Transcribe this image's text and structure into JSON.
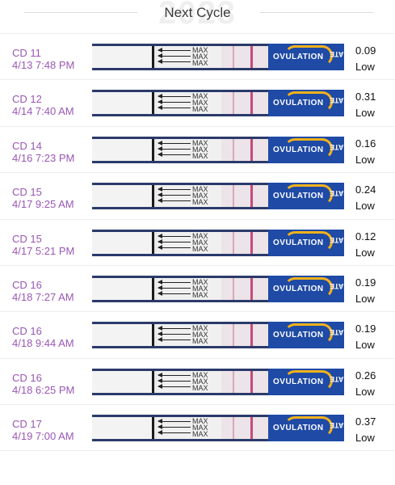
{
  "header": {
    "title": "Next Cycle",
    "watermark": "2023"
  },
  "strip_text": {
    "max_label": "MAX",
    "brand_word": "OVULATION",
    "brand_word_reversed": "MATE"
  },
  "colors": {
    "date_purple": "#9a57b5",
    "brand_blue": "#1f4aa5",
    "brand_yellow": "#f4b21b",
    "control_line": "#c84a7a"
  },
  "tests": [
    {
      "cycle_day": "CD 11",
      "timestamp": "4/13 7:48 PM",
      "value": "0.09",
      "level": "Low"
    },
    {
      "cycle_day": "CD 12",
      "timestamp": "4/14 7:40 AM",
      "value": "0.31",
      "level": "Low"
    },
    {
      "cycle_day": "CD 14",
      "timestamp": "4/16 7:23 PM",
      "value": "0.16",
      "level": "Low"
    },
    {
      "cycle_day": "CD 15",
      "timestamp": "4/17 9:25 AM",
      "value": "0.24",
      "level": "Low"
    },
    {
      "cycle_day": "CD 15",
      "timestamp": "4/17 5:21 PM",
      "value": "0.12",
      "level": "Low"
    },
    {
      "cycle_day": "CD 16",
      "timestamp": "4/18 7:27 AM",
      "value": "0.19",
      "level": "Low"
    },
    {
      "cycle_day": "CD 16",
      "timestamp": "4/18 9:44 AM",
      "value": "0.19",
      "level": "Low"
    },
    {
      "cycle_day": "CD 16",
      "timestamp": "4/18 6:25 PM",
      "value": "0.26",
      "level": "Low"
    },
    {
      "cycle_day": "CD 17",
      "timestamp": "4/19 7:00 AM",
      "value": "0.37",
      "level": "Low"
    }
  ]
}
